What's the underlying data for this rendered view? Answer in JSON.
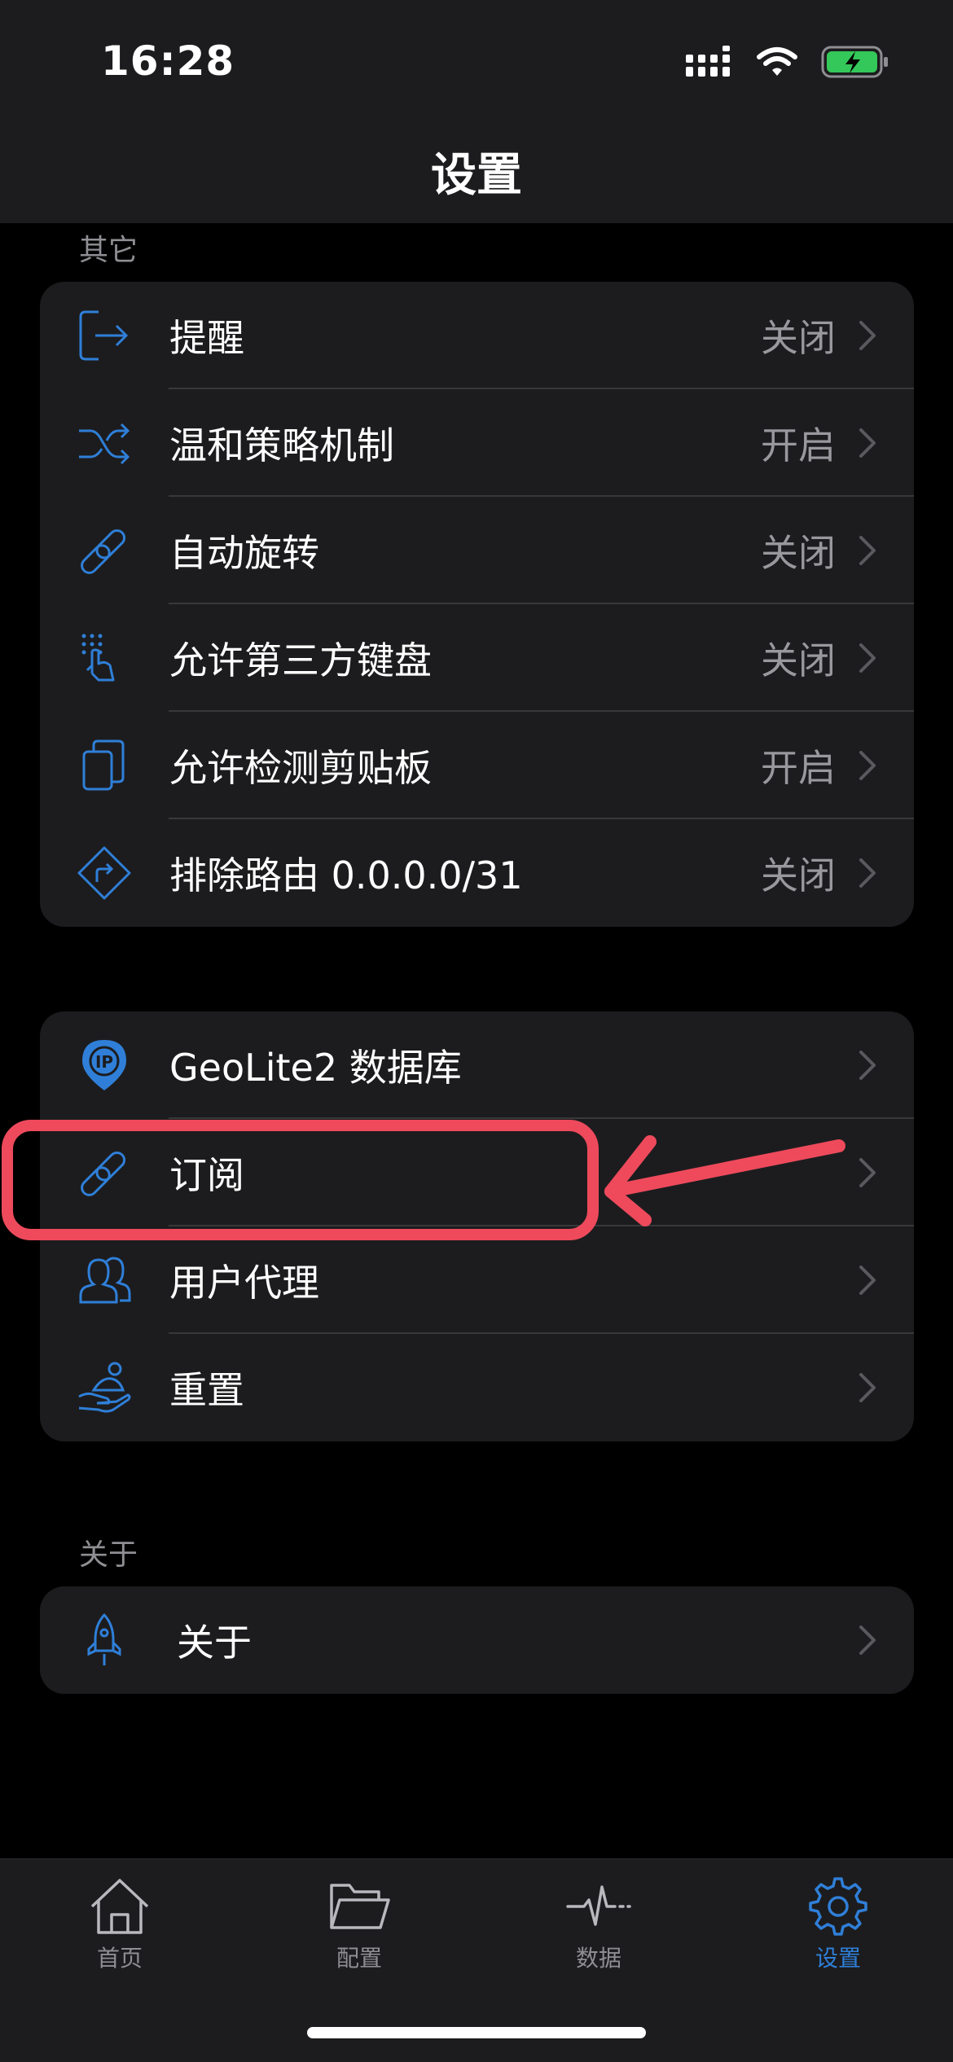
{
  "status": {
    "time": "16:28"
  },
  "nav": {
    "title": "设置"
  },
  "sections": {
    "other": {
      "header": "其它",
      "rows": [
        {
          "icon": "exit-icon",
          "label": "提醒",
          "value": "关闭"
        },
        {
          "icon": "shuffle-icon",
          "label": "温和策略机制",
          "value": "开启"
        },
        {
          "icon": "link-icon",
          "label": "自动旋转",
          "value": "关闭"
        },
        {
          "icon": "tap-gesture-icon",
          "label": "允许第三方键盘",
          "value": "关闭"
        },
        {
          "icon": "copy-icon",
          "label": "允许检测剪贴板",
          "value": "开启"
        },
        {
          "icon": "route-icon",
          "label": "排除路由 0.0.0.0/31",
          "value": "关闭"
        }
      ]
    },
    "data": {
      "rows": [
        {
          "icon": "ip-location-icon",
          "label": "GeoLite2 数据库"
        },
        {
          "icon": "link-icon",
          "label": "订阅"
        },
        {
          "icon": "users-icon",
          "label": "用户代理"
        },
        {
          "icon": "hand-person-icon",
          "label": "重置"
        }
      ]
    },
    "about": {
      "header": "关于",
      "rows": [
        {
          "icon": "rocket-icon",
          "label": "关于"
        }
      ]
    }
  },
  "tabbar": {
    "tabs": [
      {
        "icon": "home-icon",
        "label": "首页",
        "active": false
      },
      {
        "icon": "folder-icon",
        "label": "配置",
        "active": false
      },
      {
        "icon": "activity-icon",
        "label": "数据",
        "active": false
      },
      {
        "icon": "gear-icon",
        "label": "设置",
        "active": true
      }
    ]
  },
  "colors": {
    "accent": "#2f7fd8",
    "annotation": "#ee4a5c",
    "battery": "#34c759"
  }
}
